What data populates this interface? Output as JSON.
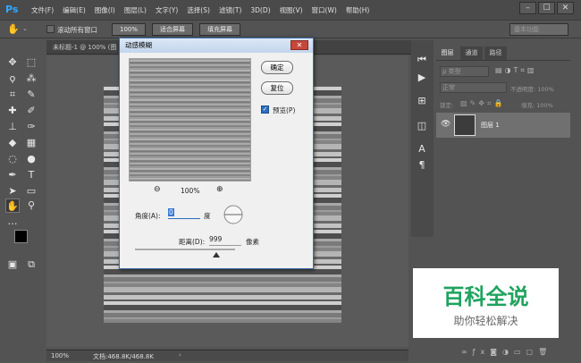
{
  "app": {
    "logo": "Ps"
  },
  "menu": [
    "文件(F)",
    "编辑(E)",
    "图像(I)",
    "图层(L)",
    "文字(Y)",
    "选择(S)",
    "滤镜(T)",
    "3D(D)",
    "视图(V)",
    "窗口(W)",
    "帮助(H)"
  ],
  "window_buttons": [
    "–",
    "☐",
    "✕"
  ],
  "options_bar": {
    "scroll_all": "滚动所有窗口",
    "zoom": "100%",
    "fit_screen": "适合屏幕",
    "fill_screen": "填充屏幕",
    "workspace": "基本功能"
  },
  "document": {
    "tab": "未标题-1 @ 100% (图",
    "zoom": "100%",
    "doc_info": "文档:468.8K/468.8K"
  },
  "dialog": {
    "title": "动感模糊",
    "ok": "确定",
    "reset": "复位",
    "preview_label": "预览(P)",
    "preview_zoom": "100%",
    "angle_label": "角度(A):",
    "angle_value": "0",
    "angle_unit": "度",
    "distance_label": "距离(D):",
    "distance_value": "999",
    "distance_unit": "像素"
  },
  "layers_panel": {
    "tabs": [
      "图层",
      "通道",
      "路径"
    ],
    "kind": "ρ 类型",
    "blend_mode": "正常",
    "opacity_label": "不透明度: 100%",
    "lock_label": "锁定:",
    "fill_label": "填充: 100%",
    "layer_name": "图层 1"
  },
  "watermark": {
    "title": "百科全说",
    "subtitle": "助你轻松解决"
  }
}
